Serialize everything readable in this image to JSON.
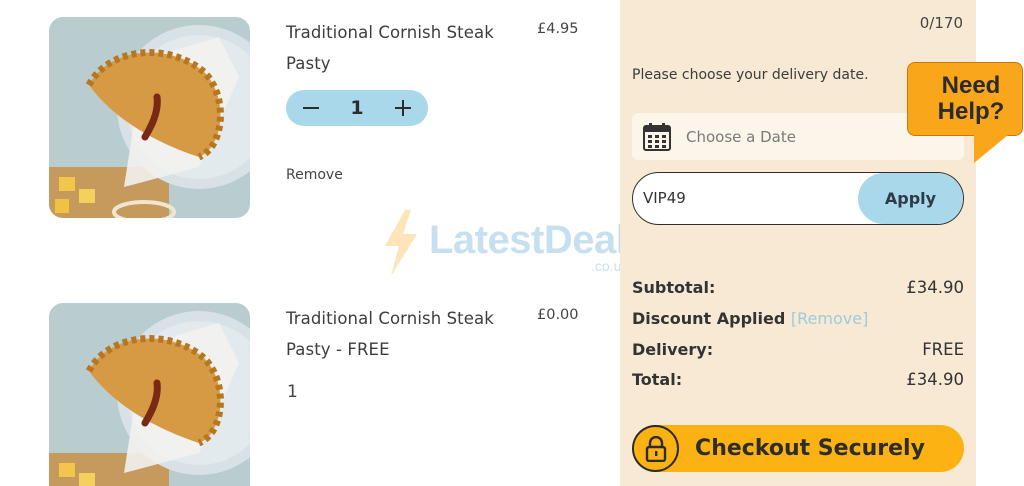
{
  "cart": {
    "items": [
      {
        "name": "Traditional Cornish Steak Pasty",
        "price": "£4.95",
        "quantity": "1",
        "remove_label": "Remove",
        "image": "pasty-photo"
      },
      {
        "name": "Traditional Cornish Steak Pasty - FREE",
        "price": "£0.00",
        "quantity": "1",
        "image": "pasty-photo"
      }
    ],
    "stepper": {
      "minus_icon": "minus-icon",
      "plus_icon": "plus-icon"
    }
  },
  "sidebar": {
    "char_counter": "0/170",
    "delivery_prompt": "Please choose your delivery date.",
    "date_placeholder": "Choose a Date",
    "date_icon": "calendar-icon",
    "promo_code": "VIP49",
    "apply_label": "Apply",
    "summary": {
      "subtotal_label": "Subtotal:",
      "subtotal_value": "£34.90",
      "discount_label": "Discount Applied",
      "discount_remove": "[Remove]",
      "delivery_label": "Delivery:",
      "delivery_value": "FREE",
      "total_label": "Total:",
      "total_value": "£34.90"
    },
    "checkout_label": "Checkout Securely",
    "checkout_icon": "lock-icon"
  },
  "help": {
    "label_line1": "Need",
    "label_line2": "Help?"
  },
  "watermark": {
    "brand": "LatestDeals",
    "suffix": ".co.uk"
  },
  "colors": {
    "panel_bg": "#f7e9d3",
    "accent_blue": "#a9d8ea",
    "checkout_orange": "#fcb212",
    "help_orange": "#f9a61b",
    "remove_link": "#9dcbe0"
  }
}
